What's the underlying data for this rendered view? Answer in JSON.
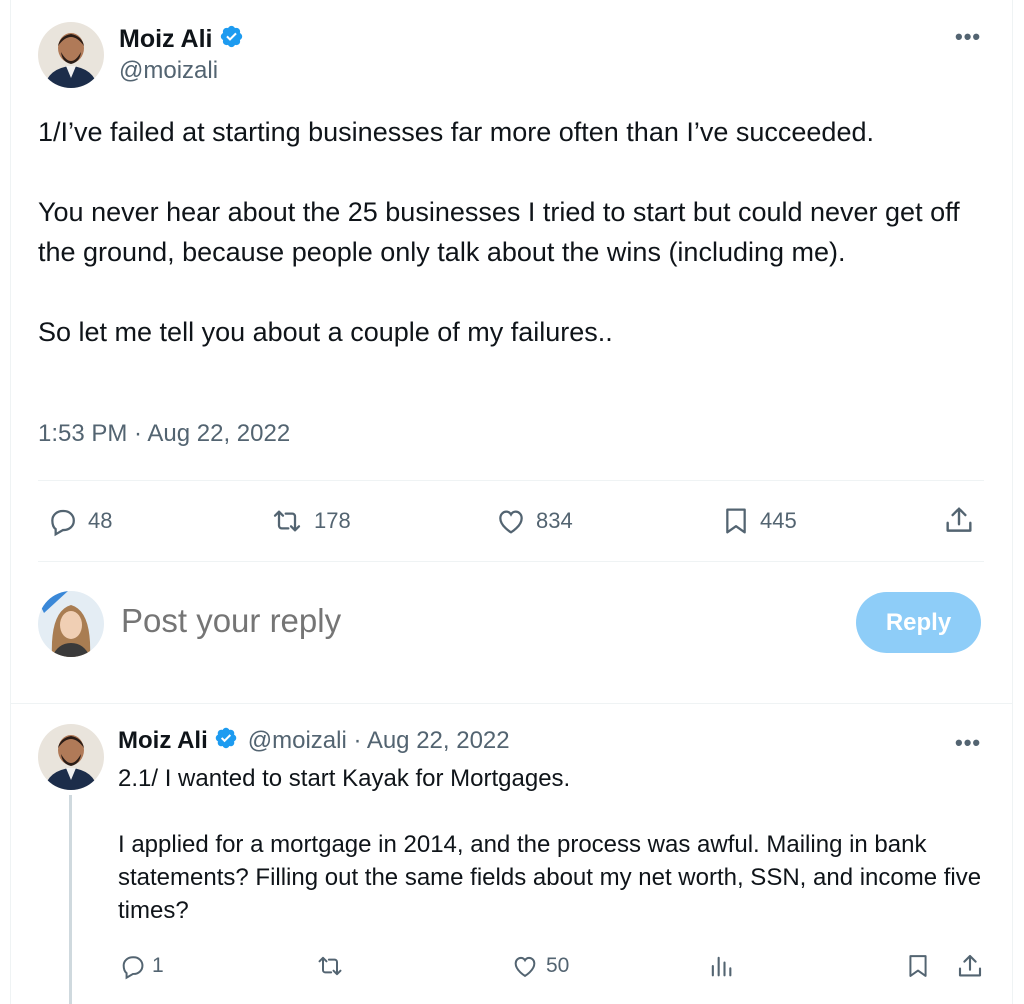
{
  "main_tweet": {
    "author_name": "Moiz Ali",
    "author_handle": "@moizali",
    "paragraphs": [
      "1/I’ve failed at starting businesses far more often than I’ve succeeded.",
      "You never hear about the 25 businesses I tried to start but could never get off the ground, because people only talk about the wins (including me).",
      "So let me tell you about a couple of my failures.."
    ],
    "timestamp": "1:53 PM · Aug 22, 2022",
    "replies": "48",
    "reposts": "178",
    "likes": "834",
    "bookmarks": "445"
  },
  "compose": {
    "placeholder": "Post your reply",
    "button_label": "Reply"
  },
  "reply_tweet": {
    "author_name": "Moiz Ali",
    "meta": "@moizali · Aug 22, 2022",
    "paragraphs": [
      "2.1/ I wanted to start Kayak for Mortgages.",
      "I applied for a mortgage in 2014, and the process was awful. Mailing in bank statements? Filling out the same fields about my net worth, SSN, and income five times?"
    ],
    "replies": "1",
    "likes": "50"
  },
  "colors": {
    "verified_blue": "#1d9bf0",
    "muted_text": "#536471",
    "reply_button_disabled": "#8ecdf8"
  },
  "icons": [
    "verified-badge-icon",
    "more-icon",
    "reply-icon",
    "repost-icon",
    "like-icon",
    "bookmark-icon",
    "share-icon",
    "views-icon"
  ]
}
